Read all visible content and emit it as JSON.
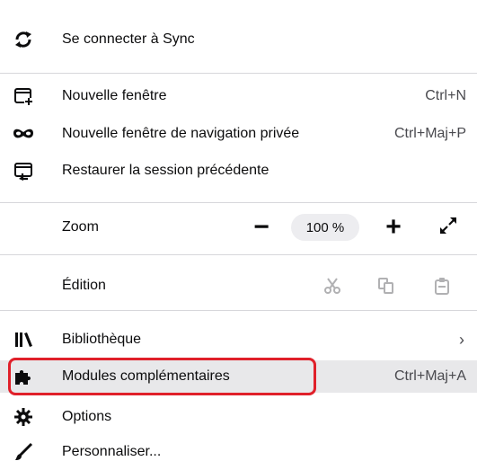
{
  "menu": {
    "sync": {
      "label": "Se connecter à Sync",
      "icon": "sync-icon"
    },
    "new_window": {
      "label": "Nouvelle fenêtre",
      "shortcut": "Ctrl+N",
      "icon": "new-window-icon"
    },
    "private_window": {
      "label": "Nouvelle fenêtre de navigation privée",
      "shortcut": "Ctrl+Maj+P",
      "icon": "private-mask-icon"
    },
    "restore_session": {
      "label": "Restaurer la session précédente",
      "icon": "restore-session-icon"
    },
    "zoom": {
      "label": "Zoom",
      "value": "100 %",
      "minus": "−",
      "plus": "+"
    },
    "edit": {
      "label": "Édition"
    },
    "library": {
      "label": "Bibliothèque",
      "chevron": "›",
      "icon": "library-icon"
    },
    "addons": {
      "label": "Modules complémentaires",
      "shortcut": "Ctrl+Maj+A",
      "icon": "puzzle-icon"
    },
    "options": {
      "label": "Options",
      "icon": "gear-icon"
    },
    "customize": {
      "label": "Personnaliser...",
      "icon": "paintbrush-icon"
    }
  },
  "colors": {
    "highlight": "#e8e8ea",
    "annotation_frame": "#e0202a",
    "separator": "#d7d7db"
  }
}
